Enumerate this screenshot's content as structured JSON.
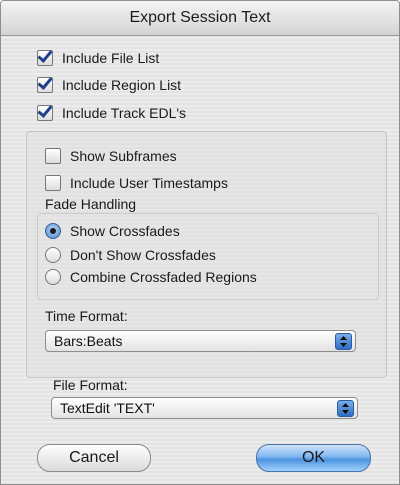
{
  "dialog": {
    "title": "Export Session Text"
  },
  "include": [
    {
      "label": "Include File List",
      "checked": true
    },
    {
      "label": "Include Region List",
      "checked": true
    },
    {
      "label": "Include Track EDL's",
      "checked": true
    }
  ],
  "options": {
    "show_subframes": {
      "label": "Show Subframes",
      "checked": false
    },
    "include_user_timestamps": {
      "label": "Include User Timestamps",
      "checked": false
    }
  },
  "fade_handling": {
    "label": "Fade Handling",
    "options": [
      {
        "label": "Show Crossfades",
        "selected": true
      },
      {
        "label": "Don't Show Crossfades",
        "selected": false
      },
      {
        "label": "Combine Crossfaded Regions",
        "selected": false
      }
    ]
  },
  "time_format": {
    "label": "Time Format:",
    "value": "Bars:Beats"
  },
  "file_format": {
    "label": "File Format:",
    "value": "TextEdit 'TEXT'"
  },
  "buttons": {
    "cancel": "Cancel",
    "ok": "OK"
  },
  "colors": {
    "default_button": "#4d93df",
    "checkmark": "#1f3f8a"
  }
}
